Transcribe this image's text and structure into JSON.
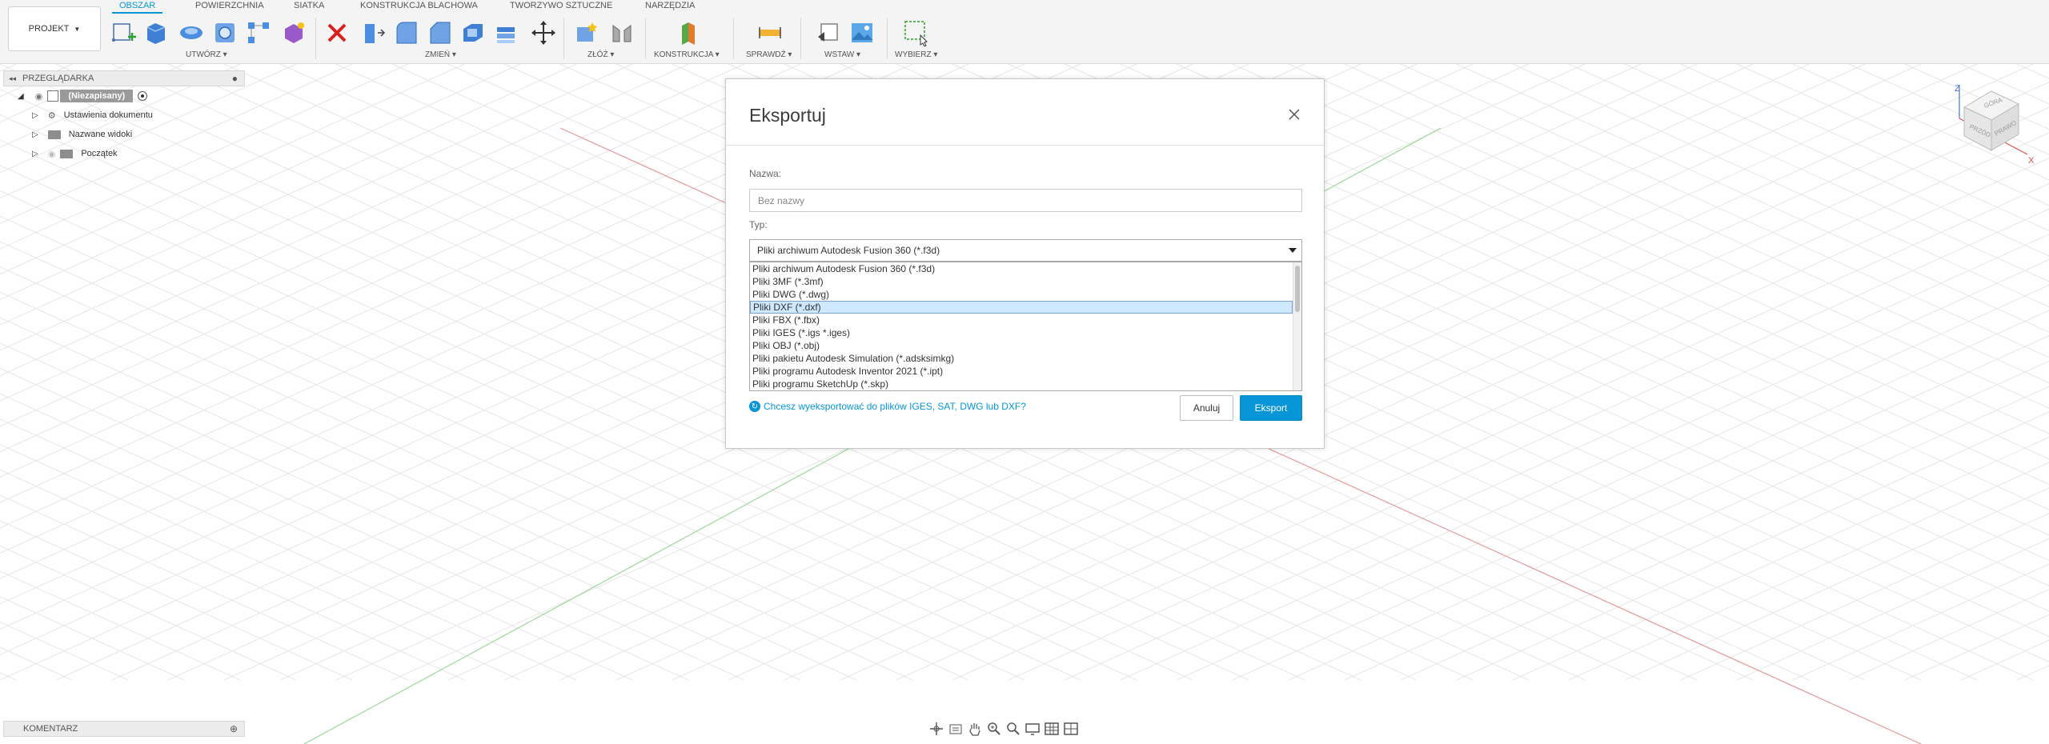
{
  "toolbar": {
    "project_label": "PROJEKT",
    "tabs": [
      {
        "label": "OBSZAR"
      },
      {
        "label": "POWIERZCHNIA"
      },
      {
        "label": "SIATKA"
      },
      {
        "label": "KONSTRUKCJA BLACHOWA"
      },
      {
        "label": "TWORZYWO SZTUCZNE"
      },
      {
        "label": "NARZĘDZIA"
      }
    ],
    "groups": [
      {
        "label": "UTWÓRZ"
      },
      {
        "label": "ZMIEŃ"
      },
      {
        "label": "ZŁÓŻ"
      },
      {
        "label": "KONSTRUKCJA"
      },
      {
        "label": "SPRAWDŹ"
      },
      {
        "label": "WSTAW"
      },
      {
        "label": "WYBIERZ"
      }
    ]
  },
  "browser": {
    "title": "PRZEGLĄDARKA",
    "root_label": "(Niezapisany)",
    "items": [
      {
        "label": "Ustawienia dokumentu"
      },
      {
        "label": "Nazwane widoki"
      },
      {
        "label": "Początek"
      }
    ]
  },
  "comments": {
    "title": "KOMENTARZ"
  },
  "dialog": {
    "title": "Eksportuj",
    "name_label": "Nazwa:",
    "name_placeholder": "Bez nazwy",
    "type_label": "Typ:",
    "type_selected": "Pliki archiwum Autodesk Fusion 360 (*.f3d)",
    "type_options": [
      {
        "label": "Pliki archiwum Autodesk Fusion 360 (*.f3d)"
      },
      {
        "label": "Pliki 3MF (*.3mf)"
      },
      {
        "label": "Pliki DWG (*.dwg)"
      },
      {
        "label": "Pliki DXF (*.dxf)",
        "highlighted": true
      },
      {
        "label": "Pliki FBX (*.fbx)"
      },
      {
        "label": "Pliki IGES (*.igs *.iges)"
      },
      {
        "label": "Pliki OBJ (*.obj)"
      },
      {
        "label": "Pliki pakietu Autodesk Simulation (*.adsksimkg)"
      },
      {
        "label": "Pliki programu Autodesk Inventor 2021 (*.ipt)"
      },
      {
        "label": "Pliki programu SketchUp (*.skp)"
      }
    ],
    "help_link": "Chcesz wyeksportować do plików IGES, SAT, DWG lub DXF?",
    "cancel_label": "Anuluj",
    "export_label": "Eksport"
  },
  "viewcube": {
    "axis_z": "Z",
    "axis_x": "X",
    "faces": {
      "top": "GÓRA",
      "front": "PRZÓD",
      "right": "PRAWO"
    }
  },
  "colors": {
    "accent": "#0696d7",
    "grid": "#e4e4e4",
    "x_axis": "#e08a8a",
    "y_axis": "#8fd08f"
  }
}
